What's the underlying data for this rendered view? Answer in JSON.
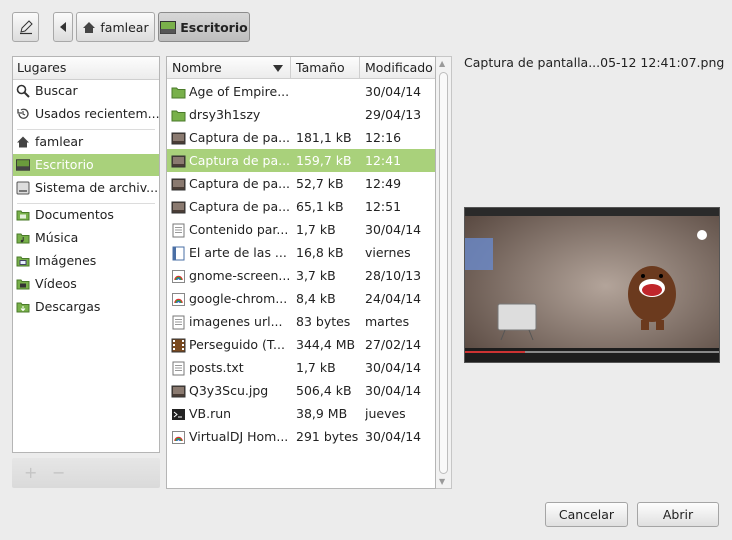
{
  "toolbar": {
    "edit_icon": "pencil-icon",
    "back_icon": "left-arrow-icon",
    "crumbs": [
      {
        "label": "famlear",
        "icon": "home-icon"
      },
      {
        "label": "Escritorio",
        "icon": "desktop-icon"
      }
    ]
  },
  "places": {
    "header": "Lugares",
    "items": [
      {
        "label": "Buscar",
        "icon": "search-icon"
      },
      {
        "label": "Usados recientem...",
        "icon": "recent-icon"
      },
      {
        "label": "famlear",
        "icon": "home-icon"
      },
      {
        "label": "Escritorio",
        "icon": "desktop-icon"
      },
      {
        "label": "Sistema de archiv...",
        "icon": "drive-icon"
      },
      {
        "label": "Documentos",
        "icon": "folder-documents-icon"
      },
      {
        "label": "Música",
        "icon": "folder-music-icon"
      },
      {
        "label": "Imágenes",
        "icon": "folder-pictures-icon"
      },
      {
        "label": "Vídeos",
        "icon": "folder-videos-icon"
      },
      {
        "label": "Descargas",
        "icon": "folder-download-icon"
      }
    ],
    "add_label": "+",
    "remove_label": "−"
  },
  "files": {
    "columns": {
      "name": "Nombre",
      "size": "Tamaño",
      "modified": "Modificado"
    },
    "rows": [
      {
        "name": "Age of Empire...",
        "size": "",
        "modified": "30/04/14",
        "icon": "folder-icon"
      },
      {
        "name": "drsy3h1szy",
        "size": "",
        "modified": "29/04/13",
        "icon": "folder-icon"
      },
      {
        "name": "Captura de pa...",
        "size": "181,1 kB",
        "modified": "12:16",
        "icon": "image-icon"
      },
      {
        "name": "Captura de pa...",
        "size": "159,7 kB",
        "modified": "12:41",
        "icon": "image-icon"
      },
      {
        "name": "Captura de pa...",
        "size": "52,7 kB",
        "modified": "12:49",
        "icon": "image-icon"
      },
      {
        "name": "Captura de pa...",
        "size": "65,1 kB",
        "modified": "12:51",
        "icon": "image-icon"
      },
      {
        "name": "Contenido par...",
        "size": "1,7 kB",
        "modified": "30/04/14",
        "icon": "text-file-icon"
      },
      {
        "name": "El arte de las ...",
        "size": "16,8 kB",
        "modified": "viernes",
        "icon": "document-icon"
      },
      {
        "name": "gnome-screen...",
        "size": "3,7 kB",
        "modified": "28/10/13",
        "icon": "desktop-file-icon"
      },
      {
        "name": "google-chrom...",
        "size": "8,4 kB",
        "modified": "24/04/14",
        "icon": "desktop-file-icon"
      },
      {
        "name": "imagenes url...",
        "size": "83 bytes",
        "modified": "martes",
        "icon": "text-file-icon"
      },
      {
        "name": "Perseguido (T...",
        "size": "344,4 MB",
        "modified": "27/02/14",
        "icon": "video-icon"
      },
      {
        "name": "posts.txt",
        "size": "1,7 kB",
        "modified": "30/04/14",
        "icon": "text-file-icon"
      },
      {
        "name": "Q3y3Scu.jpg",
        "size": "506,4 kB",
        "modified": "30/04/14",
        "icon": "image-icon"
      },
      {
        "name": "VB.run",
        "size": "38,9 MB",
        "modified": "jueves",
        "icon": "executable-icon"
      },
      {
        "name": "VirtualDJ Hom...",
        "size": "291 bytes",
        "modified": "30/04/14",
        "icon": "desktop-file-icon"
      }
    ],
    "selected_index": 3
  },
  "preview": {
    "filename": "Captura de pantalla...05-12 12:41:07.png"
  },
  "buttons": {
    "cancel": "Cancelar",
    "open": "Abrir"
  },
  "colors": {
    "selection": "#a9d17b",
    "folder": "#78b04a"
  }
}
